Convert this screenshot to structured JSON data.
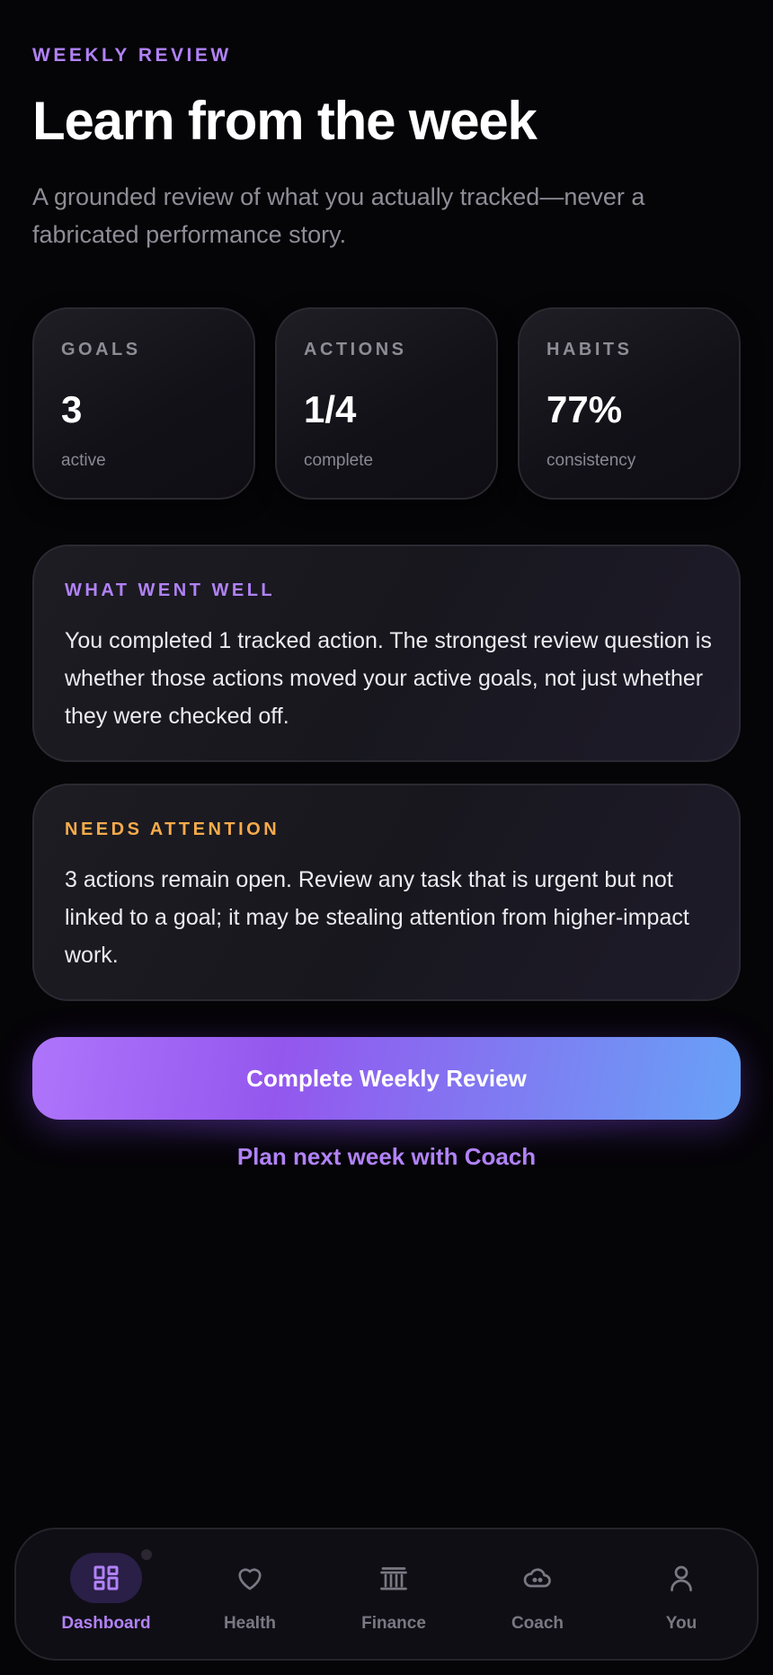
{
  "header": {
    "eyebrow": "WEEKLY REVIEW",
    "title": "Learn from the week",
    "subtitle": "A grounded review of what you actually tracked—never a fabricated performance story."
  },
  "stats": [
    {
      "label": "GOALS",
      "value": "3",
      "sub": "active"
    },
    {
      "label": "ACTIONS",
      "value": "1/4",
      "sub": "complete"
    },
    {
      "label": "HABITS",
      "value": "77%",
      "sub": "consistency"
    }
  ],
  "cards": {
    "well": {
      "label": "WHAT WENT WELL",
      "body": "You completed 1 tracked action. The strongest review question is whether those actions moved your active goals, not just whether they were checked off."
    },
    "attention": {
      "label": "NEEDS ATTENTION",
      "body": "3 actions remain open. Review any task that is urgent but not linked to a goal; it may be stealing attention from higher-impact work."
    }
  },
  "actions": {
    "primary": "Complete Weekly Review",
    "secondary": "Plan next week with Coach"
  },
  "tabbar": {
    "items": [
      {
        "label": "Dashboard",
        "icon": "dashboard-icon",
        "active": true
      },
      {
        "label": "Health",
        "icon": "heart-icon",
        "active": false
      },
      {
        "label": "Finance",
        "icon": "bank-icon",
        "active": false
      },
      {
        "label": "Coach",
        "icon": "coach-icon",
        "active": false
      },
      {
        "label": "You",
        "icon": "person-icon",
        "active": false
      }
    ]
  },
  "colors": {
    "accent": "#b182f7",
    "warning": "#f7ab4b",
    "background": "#050407",
    "cta_start": "#ae75fb",
    "cta_end": "#67a2f7"
  }
}
